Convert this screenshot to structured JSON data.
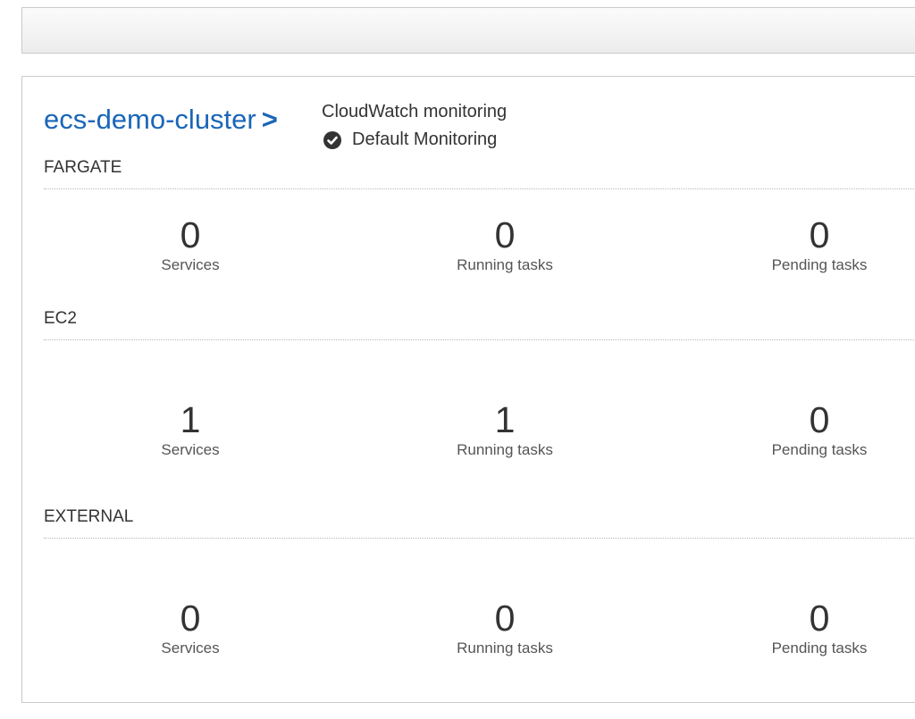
{
  "cluster": {
    "name": "ecs-demo-cluster",
    "chevron": ">"
  },
  "monitoring": {
    "label": "CloudWatch monitoring",
    "value": "Default Monitoring",
    "icon": "check-circle-icon"
  },
  "sections": [
    {
      "title": "FARGATE",
      "stats": [
        {
          "value": "0",
          "label": "Services"
        },
        {
          "value": "0",
          "label": "Running tasks"
        },
        {
          "value": "0",
          "label": "Pending tasks"
        }
      ]
    },
    {
      "title": "EC2",
      "stats": [
        {
          "value": "1",
          "label": "Services"
        },
        {
          "value": "1",
          "label": "Running tasks"
        },
        {
          "value": "0",
          "label": "Pending tasks"
        }
      ]
    },
    {
      "title": "EXTERNAL",
      "stats": [
        {
          "value": "0",
          "label": "Services"
        },
        {
          "value": "0",
          "label": "Running tasks"
        },
        {
          "value": "0",
          "label": "Pending tasks"
        }
      ]
    }
  ],
  "colors": {
    "link": "#1a66b8",
    "text": "#333333",
    "muted": "#555555",
    "border": "#c9c9c9"
  }
}
